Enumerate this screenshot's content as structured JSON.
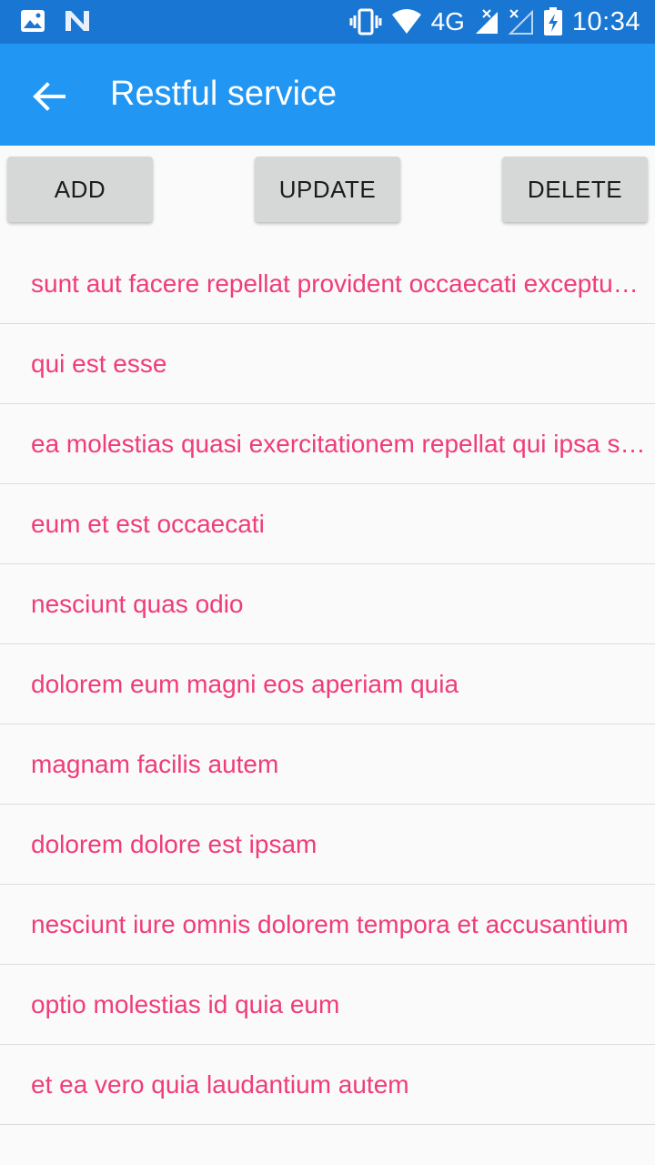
{
  "status_bar": {
    "left_icons": [
      "image-icon",
      "n-notification-icon"
    ],
    "right_icons": [
      "vibrate-icon",
      "wifi-icon",
      "signal-icon",
      "signal-x-icon",
      "battery-charging-icon"
    ],
    "network": "4G",
    "time": "10:34"
  },
  "app_bar": {
    "back_icon": "arrow-back-icon",
    "title": "Restful service",
    "color": "#2196f3"
  },
  "buttons": {
    "add": "ADD",
    "update": "UPDATE",
    "delete": "DELETE"
  },
  "list": {
    "item_color": "#f03c78",
    "items": [
      "sunt aut facere repellat provident occaecati excepturi optio reprehenderit",
      "qui est esse",
      "ea molestias quasi exercitationem repellat qui ipsa sit aut",
      "eum et est occaecati",
      "nesciunt quas odio",
      "dolorem eum magni eos aperiam quia",
      "magnam facilis autem",
      "dolorem dolore est ipsam",
      "nesciunt iure omnis dolorem tempora et accusantium",
      "optio molestias id quia eum",
      "et ea vero quia laudantium autem"
    ]
  }
}
